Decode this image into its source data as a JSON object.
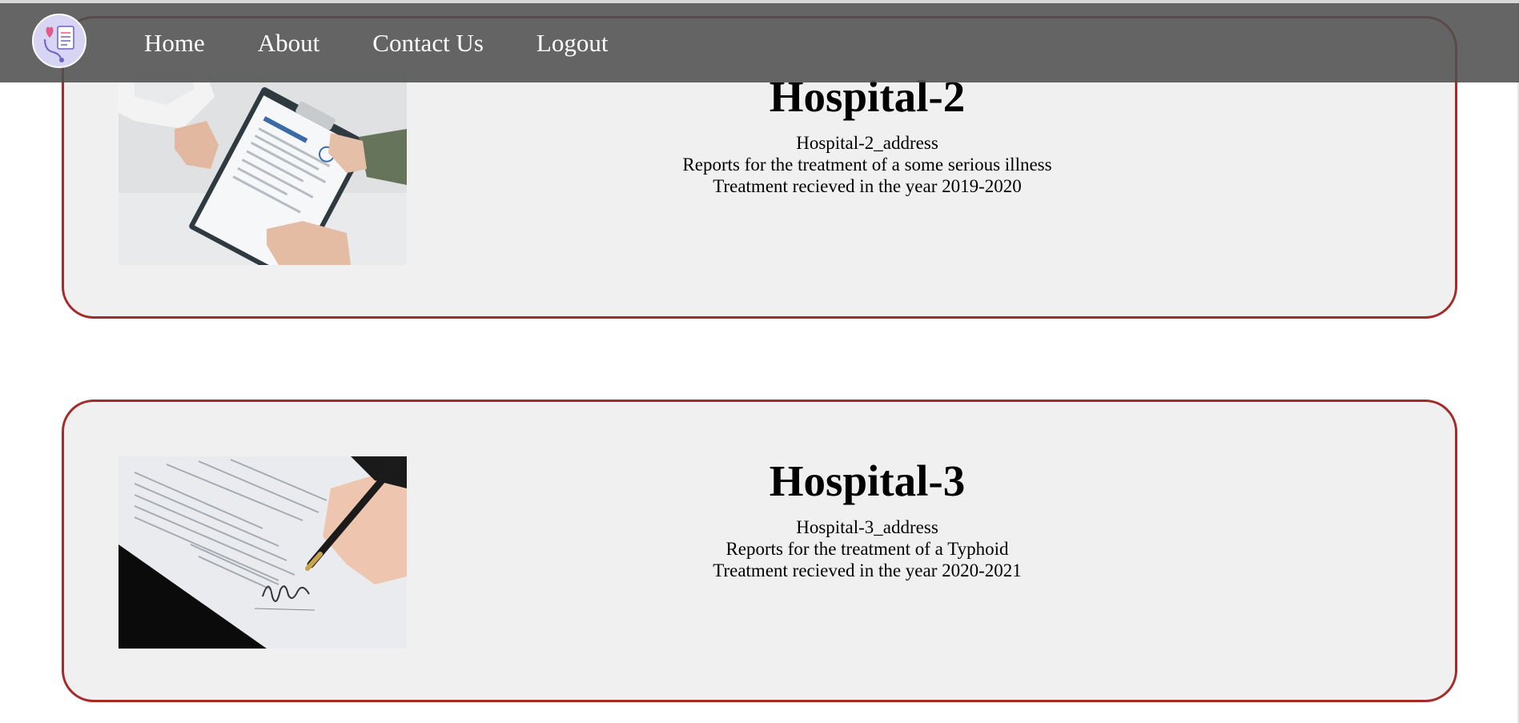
{
  "nav": {
    "logo_icon": "medical-report-stethoscope-icon",
    "items": [
      {
        "label": "Home"
      },
      {
        "label": "About"
      },
      {
        "label": "Contact Us"
      },
      {
        "label": "Logout"
      }
    ]
  },
  "records": [
    {
      "title": "Hospital-2",
      "address": "Hospital-2_address",
      "report": "Reports for the treatment of a some serious illness",
      "year": "Treatment recieved in the year 2019-2020",
      "image_icon": "clipboard-handover-photo"
    },
    {
      "title": "Hospital-3",
      "address": "Hospital-3_address",
      "report": "Reports for the treatment of a Typhoid",
      "year": "Treatment recieved in the year 2020-2021",
      "image_icon": "document-signing-photo"
    }
  ],
  "colors": {
    "card_border": "#a52a2a",
    "card_background": "#f1f0f0",
    "navbar_background": "#505050"
  }
}
